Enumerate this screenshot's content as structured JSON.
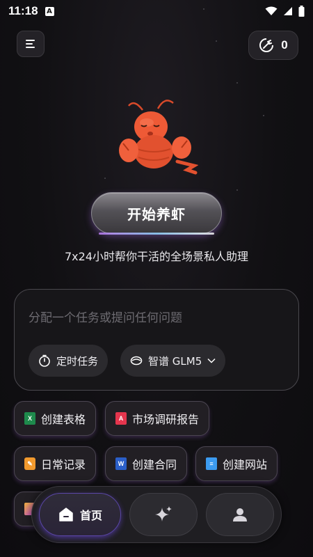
{
  "status_bar": {
    "time": "11:18",
    "notification_badge": "A",
    "icons": [
      "wifi-icon",
      "signal-icon",
      "battery-icon"
    ]
  },
  "header": {
    "menu_icon": "hamburger-icon",
    "credit_icon": "shrimp-coin-icon",
    "credit_count": "0"
  },
  "hero": {
    "mascot": "lobster-mascot",
    "start_button_label": "开始养虾",
    "subtitle": "7x24小时帮你干活的全场景私人助理"
  },
  "composer": {
    "placeholder": "分配一个任务或提问任何问题",
    "scheduled_task_label": "定时任务",
    "model_label": "智谱 GLM5"
  },
  "quick_actions": [
    {
      "label": "创建表格",
      "icon": "excel-icon",
      "color": "#1e8a4c"
    },
    {
      "label": "市场调研报告",
      "icon": "pdf-icon",
      "color": "#e5354d"
    },
    {
      "label": "日常记录",
      "icon": "note-icon",
      "color": "#f29a2e"
    },
    {
      "label": "创建合同",
      "icon": "word-icon",
      "color": "#2b5fc8"
    },
    {
      "label": "创建网站",
      "icon": "website-icon",
      "color": "#3c9bf0"
    }
  ],
  "tabbar": {
    "home_label": "首页",
    "items": [
      "home-icon",
      "sparkle-icon",
      "profile-icon"
    ]
  },
  "colors": {
    "background": "#121114",
    "accent": "#7b5cff"
  }
}
